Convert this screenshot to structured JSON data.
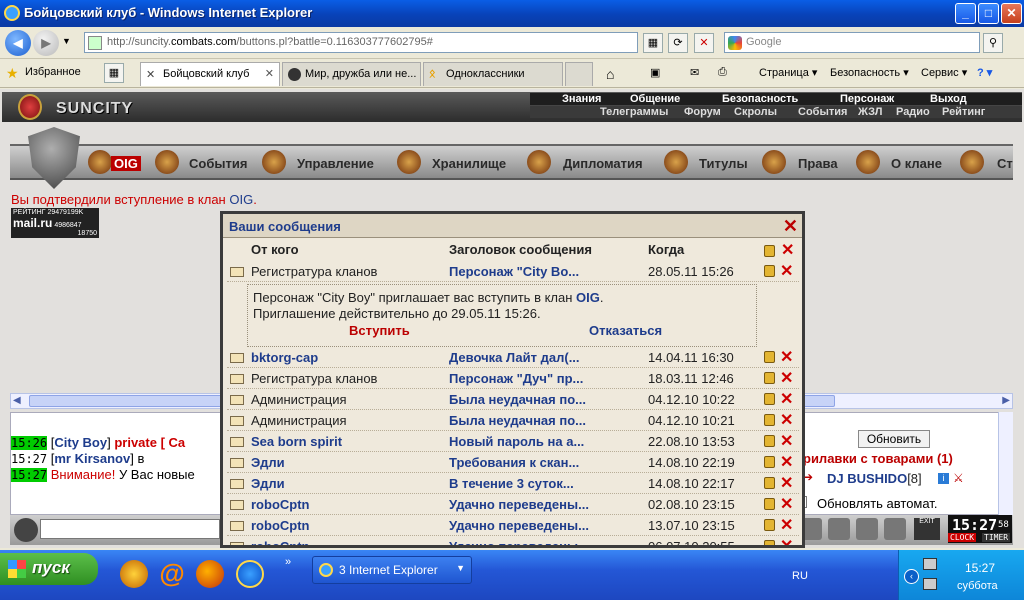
{
  "window": {
    "title": "Бойцовский клуб - Windows Internet Explorer"
  },
  "browser": {
    "url_prefix": "http://suncity.",
    "url_domain": "combats.com",
    "url_suffix": "/buttons.pl?battle=0.116303777602795#",
    "search_placeholder": "Google",
    "favorites_label": "Избранное",
    "tabs": [
      {
        "label": "Бойцовский клуб"
      },
      {
        "label": "Мир, дружба или не..."
      },
      {
        "label": "Одноклассники"
      }
    ],
    "menu": {
      "page": "Страница",
      "safety": "Безопасность",
      "service": "Сервис"
    }
  },
  "game": {
    "logo": "SUNCITY",
    "top_nav_1": [
      "Знания",
      "Общение",
      "Безопасность",
      "Персонаж",
      "Выход"
    ],
    "top_nav_2": [
      "Телеграммы",
      "Форум",
      "Скролы",
      "События",
      "ЖЗЛ",
      "Радио",
      "Рейтинг"
    ],
    "main_nav": [
      "OIG",
      "События",
      "Управление",
      "Хранилище",
      "Дипломатия",
      "Титулы",
      "Права",
      "О клане",
      "Ст"
    ],
    "confirm_text": "Вы подтвердили вступление в клан ",
    "confirm_clan": "OIG",
    "confirm_dot": ".",
    "rating": {
      "l1": "РЕЙТИНГ 29479199K",
      "brand": "mail.ru",
      "l2": "4986847",
      "l3": "18750"
    }
  },
  "chat": {
    "lines": [
      {
        "time": "15:26",
        "nick": "City Boy",
        "rest": "private [ Ca"
      },
      {
        "time": "15:27",
        "nick": "mr Kirsanov",
        "rest": "в"
      },
      {
        "time": "15:27",
        "warn": "Внимание!",
        "rest": "У Вас новые"
      }
    ],
    "right": {
      "update_btn": "Обновить",
      "shops_title": "рилавки с товарами (1)",
      "dj": "DJ BUSHIDO",
      "dj_level": "[8]",
      "auto_update": "Обновлять автомат."
    },
    "clock": {
      "time": "15:27",
      "sec": "58",
      "l1": "CLOCK",
      "l2": "TIMER"
    }
  },
  "dialog": {
    "title": "Ваши сообщения",
    "headers": {
      "from": "От кого",
      "subject": "Заголовок сообщения",
      "when": "Когда"
    },
    "first": {
      "from": "Регистратура кланов",
      "subject": "Персонаж \"City Bo...",
      "when": "28.05.11 15:26"
    },
    "expanded": {
      "line1_a": "Персонаж \"City Boy\" приглашает вас вступить в клан ",
      "line1_clan": "OIG",
      "line1_b": ".",
      "line2": "Приглашение действительно до 29.05.11 15:26.",
      "accept": "Вступить",
      "decline": "Отказаться"
    },
    "rows": [
      {
        "from": "bktorg-cap",
        "bold": true,
        "subject": "Девочка Лайт дал(...",
        "when": "14.04.11 16:30"
      },
      {
        "from": "Регистратура кланов",
        "bold": false,
        "subject": "Персонаж \"Дуч\" пр...",
        "when": "18.03.11 12:46"
      },
      {
        "from": "Администрация",
        "bold": false,
        "subject": "Была неудачная по...",
        "when": "04.12.10 10:22"
      },
      {
        "from": "Администрация",
        "bold": false,
        "subject": "Была неудачная по...",
        "when": "04.12.10 10:21"
      },
      {
        "from": "Sea born spirit",
        "bold": true,
        "subject": "Новый пароль на а...",
        "when": "22.08.10 13:53"
      },
      {
        "from": "Эдли",
        "bold": true,
        "subject": "Требования к скан...",
        "when": "14.08.10 22:19"
      },
      {
        "from": "Эдли",
        "bold": true,
        "subject": "В течение 3 суток...",
        "when": "14.08.10 22:17"
      },
      {
        "from": "roboCptn",
        "bold": true,
        "subject": "Удачно переведены...",
        "when": "02.08.10 23:15"
      },
      {
        "from": "roboCptn",
        "bold": true,
        "subject": "Удачно переведены...",
        "when": "13.07.10 23:15"
      },
      {
        "from": "roboCptn",
        "bold": true,
        "subject": "Удачно переведены...",
        "when": "06.07.10 20:55"
      }
    ]
  },
  "taskbar": {
    "start": "пуск",
    "task": "3 Internet Explorer",
    "lang": "RU",
    "time": "15:27",
    "day": "суббота"
  }
}
